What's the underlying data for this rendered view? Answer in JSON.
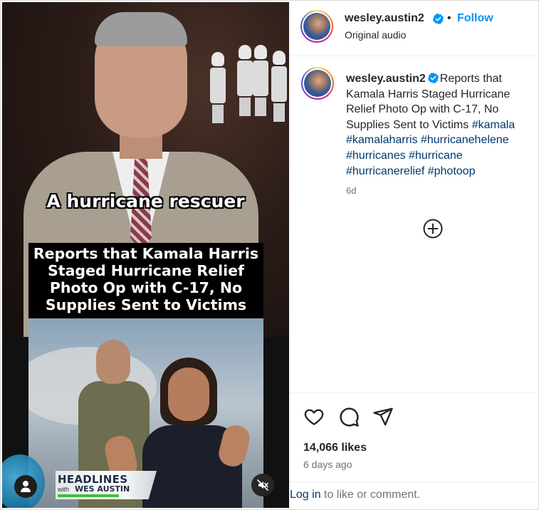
{
  "video": {
    "overlay_caption": "A hurricane rescuer",
    "headline_lines": [
      "Reports that Kamala Harris",
      "Staged Hurricane Relief",
      "Photo Op with C-17, No",
      "Supplies Sent to Victims"
    ],
    "show_logo": {
      "title": "HEADLINES",
      "with": "with",
      "name": "WES AUSTIN"
    },
    "icons": {
      "user_tag": "person-icon",
      "mute": "speaker-muted-icon"
    },
    "colors": {
      "headline_bg": "#000000",
      "logo_stripe": "#3fbf3a",
      "logo_text": "#1b2d46"
    }
  },
  "header": {
    "username": "wesley.austin2",
    "separator": "•",
    "follow_label": "Follow",
    "audio_label": "Original audio"
  },
  "caption": {
    "username": "wesley.austin2",
    "text": "Reports that Kamala Harris Staged Hurricane Relief Photo Op with C-17, No Supplies Sent to Victims",
    "hashtags": [
      "#kamala",
      "#kamalaharris",
      "#hurricanehelene",
      "#hurricanes",
      "#hurricane",
      "#hurricanerelief",
      "#photoop"
    ],
    "age": "6d"
  },
  "actions": {
    "icons": [
      "heart-icon",
      "comment-icon",
      "share-icon"
    ],
    "likes": "14,066 likes",
    "posted": "6 days ago"
  },
  "login": {
    "link": "Log in",
    "rest": "to like or comment."
  },
  "colors": {
    "link_blue": "#0095f6",
    "hashtag": "#00376b",
    "muted": "#737373",
    "verified": "#0095f6"
  }
}
